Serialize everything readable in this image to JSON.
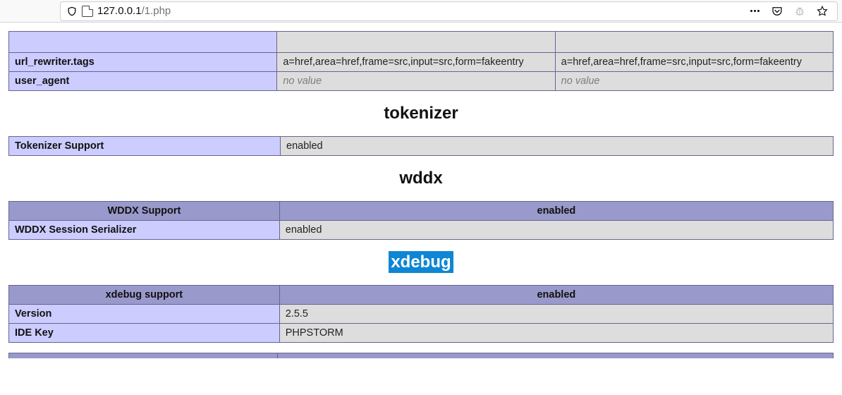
{
  "browser": {
    "url_host": "127.0.0.1",
    "url_path": "/1.php"
  },
  "topTable": {
    "rows": [
      {
        "name": "",
        "local": "",
        "master": ""
      },
      {
        "name": "url_rewriter.tags",
        "local": "a=href,area=href,frame=src,input=src,form=fakeentry",
        "master": "a=href,area=href,frame=src,input=src,form=fakeentry"
      },
      {
        "name": "user_agent",
        "local": "no value",
        "master": "no value",
        "novalue": true
      }
    ]
  },
  "sections": [
    {
      "title": "tokenizer",
      "highlight": false,
      "tables": [
        {
          "headers": null,
          "rows": [
            {
              "name": "Tokenizer Support",
              "value": "enabled"
            }
          ]
        }
      ]
    },
    {
      "title": "wddx",
      "highlight": false,
      "tables": [
        {
          "headers": [
            "WDDX Support",
            "enabled"
          ],
          "rows": [
            {
              "name": "WDDX Session Serializer",
              "value": "enabled"
            }
          ]
        }
      ]
    },
    {
      "title": "xdebug",
      "highlight": true,
      "tables": [
        {
          "headers": [
            "xdebug support",
            "enabled"
          ],
          "rows": [
            {
              "name": "Version",
              "value": "2.5.5"
            },
            {
              "name": "IDE Key",
              "value": "PHPSTORM"
            }
          ]
        }
      ]
    }
  ]
}
